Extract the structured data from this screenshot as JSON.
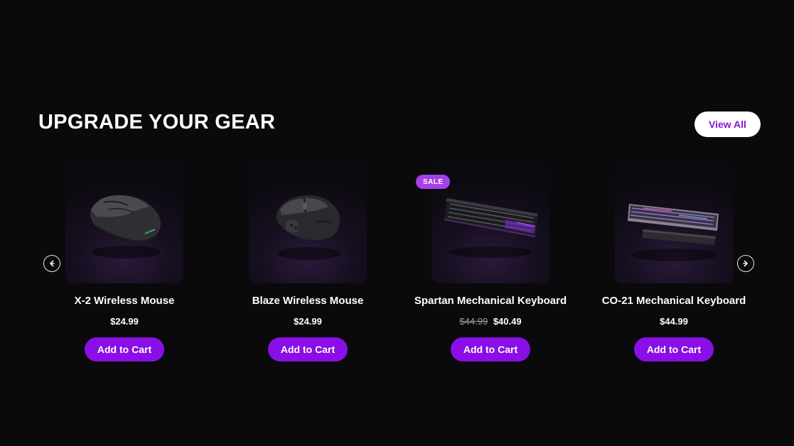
{
  "section": {
    "title": "UPGRADE YOUR GEAR",
    "view_all_label": "View All",
    "prev_icon": "arrow-left-icon",
    "next_icon": "arrow-right-icon"
  },
  "products": [
    {
      "name": "X-2 Wireless Mouse",
      "price": "$24.99",
      "old_price": "",
      "badge": "",
      "image": "wireless-mouse-image",
      "cta": "Add to Cart"
    },
    {
      "name": "Blaze Wireless Mouse",
      "price": "$24.99",
      "old_price": "",
      "badge": "",
      "image": "gaming-mouse-image",
      "cta": "Add to Cart"
    },
    {
      "name": "Spartan Mechanical Keyboard",
      "price": "$40.49",
      "old_price": "$44.99",
      "badge": "SALE",
      "image": "mechanical-keyboard-image",
      "cta": "Add to Cart"
    },
    {
      "name": "CO-21 Mechanical Keyboard",
      "price": "$44.99",
      "old_price": "",
      "badge": "",
      "image": "keyboard-with-wrist-rest-image",
      "cta": "Add to Cart"
    }
  ],
  "colors": {
    "background": "#0a090b",
    "accent": "#8a0ee6",
    "sale_badge": "#a640e6",
    "view_all_text": "#8a14d9"
  }
}
